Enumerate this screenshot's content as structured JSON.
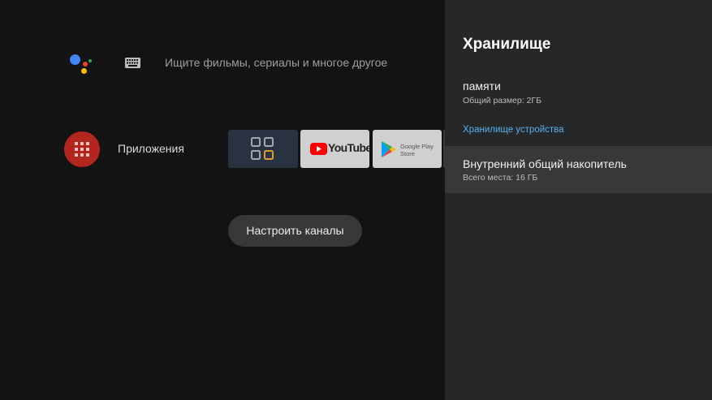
{
  "colors": {
    "background": "#131313",
    "panel": "#262728",
    "selected_row": "#36383a",
    "accent_blue": "#5ab0ef",
    "apps_red": "#b3261e"
  },
  "home": {
    "assistant_icon": "google-assistant-icon",
    "keyboard_icon": "keyboard-icon",
    "search_placeholder": "Ищите фильмы, сериалы и многое другое",
    "apps": {
      "icon": "apps-grid-icon",
      "label": "Приложения",
      "tiles": [
        {
          "name": "apps-grid",
          "icon": "grid-icon"
        },
        {
          "name": "youtube",
          "label": "YouTube",
          "icon": "youtube-icon"
        },
        {
          "name": "google-play-store",
          "label_line1": "Google Play",
          "label_line2": "Store",
          "icon": "play-icon"
        }
      ]
    },
    "channels_button": "Настроить каналы"
  },
  "panel": {
    "title": "Хранилище",
    "memory": {
      "label": "памяти",
      "detail": "Общий размер: 2ГБ"
    },
    "device_storage_header": "Хранилище устройства",
    "internal": {
      "label": "Внутренний общий накопитель",
      "detail": "Всего места: 16 ГБ"
    }
  }
}
